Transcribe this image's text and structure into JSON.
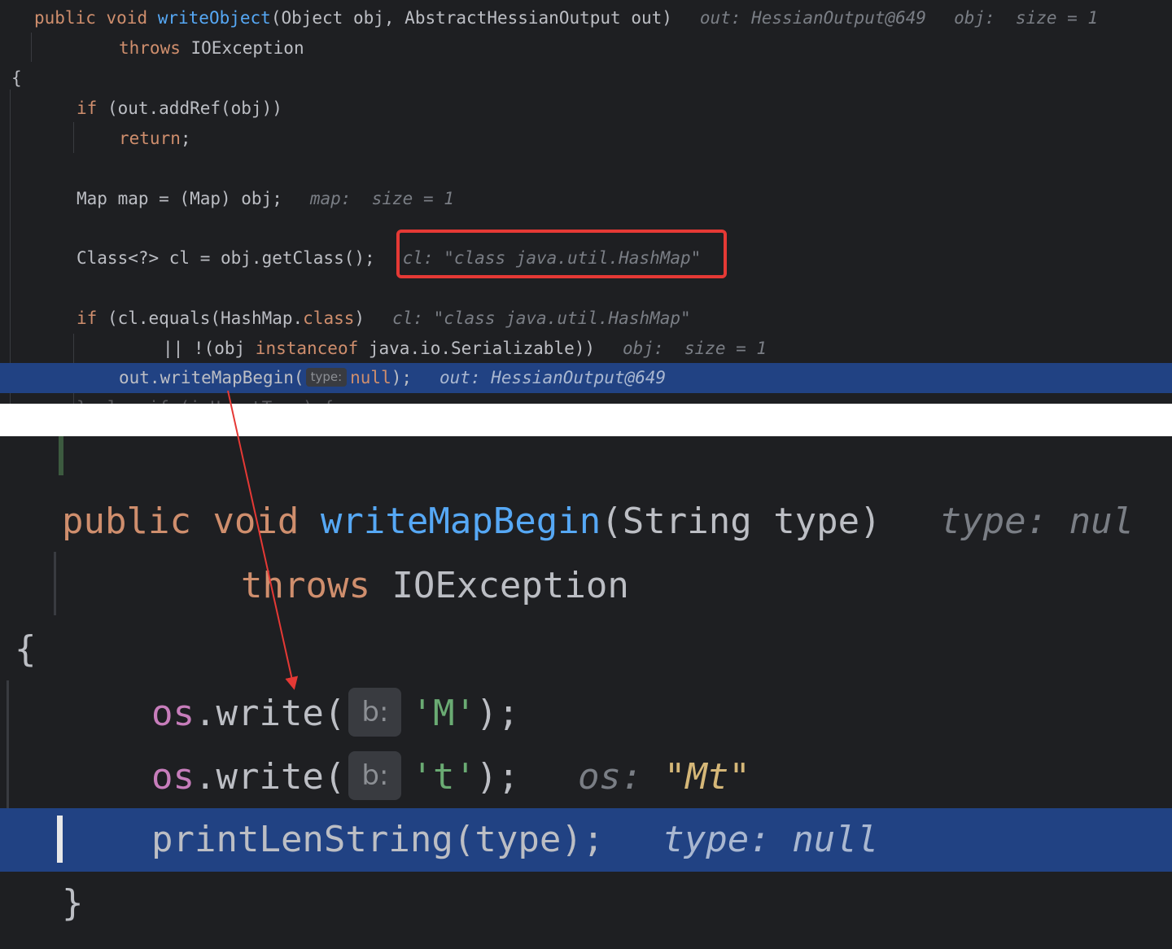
{
  "top": {
    "lines": [
      {
        "parts": [
          {
            "c": "kw",
            "t": "public "
          },
          {
            "c": "kw",
            "t": "void "
          },
          {
            "c": "fn",
            "t": "writeObject"
          },
          {
            "c": "",
            "t": "(Object obj, AbstractHessianOutput out)"
          }
        ],
        "hints": [
          {
            "t": "out: HessianOutput@649"
          },
          {
            "t": "obj:  size = 1"
          }
        ]
      },
      {
        "parts": [
          {
            "c": "kw",
            "t": "throws "
          },
          {
            "c": "",
            "t": "IOException"
          }
        ]
      },
      {
        "parts": [
          {
            "c": "",
            "t": "{"
          }
        ]
      },
      {
        "parts": [
          {
            "c": "kw",
            "t": "if "
          },
          {
            "c": "",
            "t": "(out.addRef(obj))"
          }
        ]
      },
      {
        "parts": [
          {
            "c": "kw",
            "t": "return"
          },
          {
            "c": "",
            "t": ";"
          }
        ]
      },
      {
        "parts": []
      },
      {
        "parts": [
          {
            "c": "",
            "t": "Map map = (Map) obj;"
          }
        ],
        "hints": [
          {
            "t": "map:  size = 1"
          }
        ]
      },
      {
        "parts": []
      },
      {
        "parts": [
          {
            "c": "",
            "t": "Class<?> cl = obj.getClass();"
          }
        ],
        "hints": [
          {
            "t": "cl: \"class java.util.HashMap\""
          }
        ]
      },
      {
        "parts": []
      },
      {
        "parts": [
          {
            "c": "kw",
            "t": "if "
          },
          {
            "c": "",
            "t": "(cl.equals(HashMap."
          },
          {
            "c": "kw",
            "t": "class"
          },
          {
            "c": "",
            "t": ")"
          }
        ],
        "hints": [
          {
            "t": "cl: \"class java.util.HashMap\""
          }
        ]
      },
      {
        "parts": [
          {
            "c": "",
            "t": "|| !(obj "
          },
          {
            "c": "kw",
            "t": "instanceof "
          },
          {
            "c": "",
            "t": "java.io.Serializable))"
          }
        ],
        "hints": [
          {
            "t": "obj:  size = 1"
          }
        ]
      },
      {
        "parts": [
          {
            "c": "",
            "t": "out.writeMapBegin("
          },
          {
            "c": "param",
            "t": "type:"
          },
          {
            "c": "kw",
            "t": "null"
          },
          {
            "c": "",
            "t": ");"
          }
        ],
        "hints": [
          {
            "t": "out: HessianOutput@649"
          }
        ]
      },
      {
        "parts": [
          {
            "c": "",
            "t": "} else if (isUnsetType) {"
          }
        ]
      }
    ]
  },
  "bottom": {
    "lines": [
      {
        "parts": [
          {
            "c": "kw",
            "t": "public "
          },
          {
            "c": "kw",
            "t": "void "
          },
          {
            "c": "fn",
            "t": "writeMapBegin"
          },
          {
            "c": "",
            "t": "(String type)"
          }
        ],
        "hints": [
          {
            "t": "type: nul"
          }
        ]
      },
      {
        "parts": [
          {
            "c": "kw",
            "t": "throws "
          },
          {
            "c": "",
            "t": "IOException"
          }
        ]
      },
      {
        "parts": [
          {
            "c": "",
            "t": "{"
          }
        ]
      },
      {
        "parts": [
          {
            "c": "field",
            "t": "os"
          },
          {
            "c": "",
            "t": ".write("
          },
          {
            "c": "param",
            "t": "b:"
          },
          {
            "c": "str",
            "t": "'M'"
          },
          {
            "c": "",
            "t": ");"
          }
        ]
      },
      {
        "parts": [
          {
            "c": "field",
            "t": "os"
          },
          {
            "c": "",
            "t": ".write("
          },
          {
            "c": "param",
            "t": "b:"
          },
          {
            "c": "str",
            "t": "'t'"
          },
          {
            "c": "",
            "t": ");"
          }
        ],
        "hints": [
          {
            "t": "os: ",
            "v": "\"Mt\""
          }
        ]
      },
      {
        "parts": [
          {
            "c": "",
            "t": "printLenString(type);"
          }
        ],
        "hints": [
          {
            "t": "type: null"
          }
        ]
      },
      {
        "parts": [
          {
            "c": "",
            "t": "}"
          }
        ]
      }
    ]
  },
  "colors": {
    "editor_bg": "#1e1f22",
    "exec_line": "#214283",
    "annotation": "#e53935"
  }
}
